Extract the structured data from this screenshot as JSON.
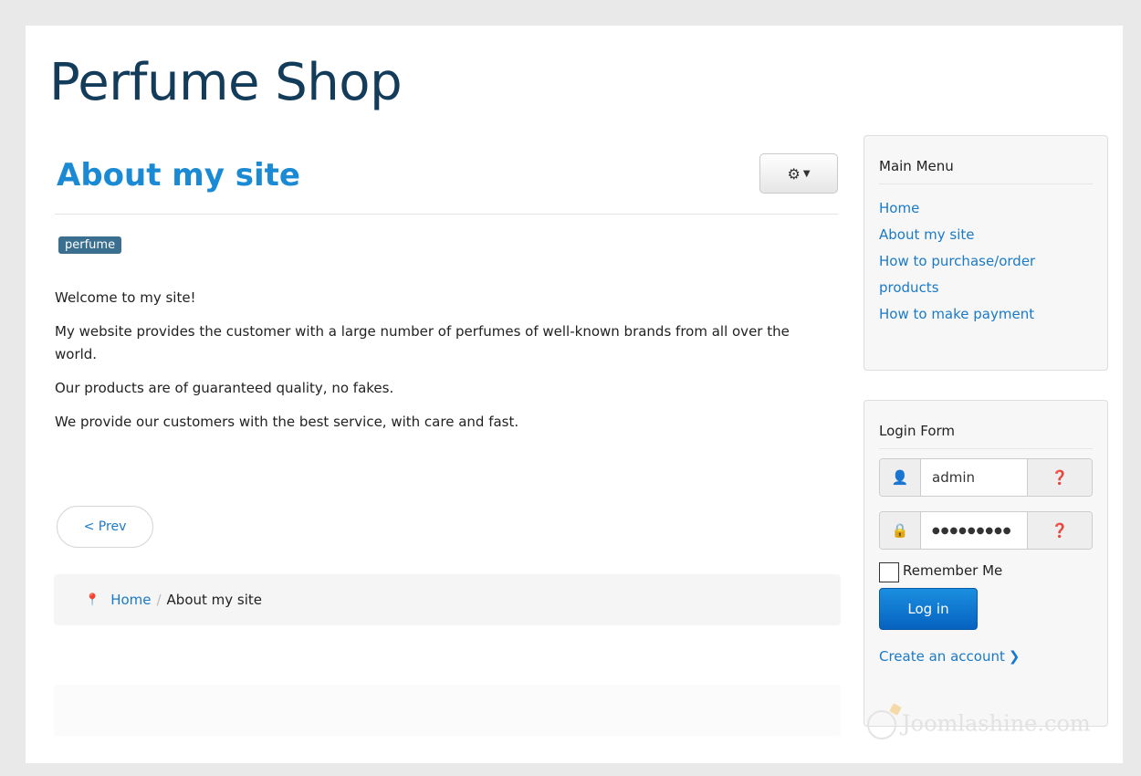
{
  "site": {
    "title": "Perfume Shop"
  },
  "article": {
    "title": "About my site",
    "tag": "perfume",
    "paragraphs": [
      "Welcome to my site!",
      "My website provides the customer with a large number of perfumes of well-known brands from all over the world.",
      "Our products are of guaranteed quality, no fakes.",
      "We provide our customers with the best service, with care and fast."
    ],
    "prev_label": "< Prev"
  },
  "breadcrumb": {
    "home": "Home",
    "separator": "/",
    "current": "About my site"
  },
  "main_menu": {
    "title": "Main Menu",
    "items": [
      "Home",
      "About my site",
      "How to purchase/order products",
      "How to make payment"
    ]
  },
  "login_form": {
    "title": "Login Form",
    "username_value": "admin",
    "password_value": "●●●●●●●●●",
    "remember_label": "Remember Me",
    "login_label": "Log in",
    "create_account_label": "Create an account"
  },
  "watermark": {
    "text": "Joomlashine.com"
  },
  "icons": {
    "gear": "gear-icon",
    "user": "user-icon",
    "lock": "lock-icon",
    "help": "question-icon",
    "pin": "map-pin-icon",
    "chevron": "chevron-right-icon"
  },
  "colors": {
    "title": "#133b5a",
    "link": "#1a7ac7",
    "heading": "#1a8ad4",
    "tag_bg": "#3a6f8f",
    "button": "#0a6fd0"
  }
}
